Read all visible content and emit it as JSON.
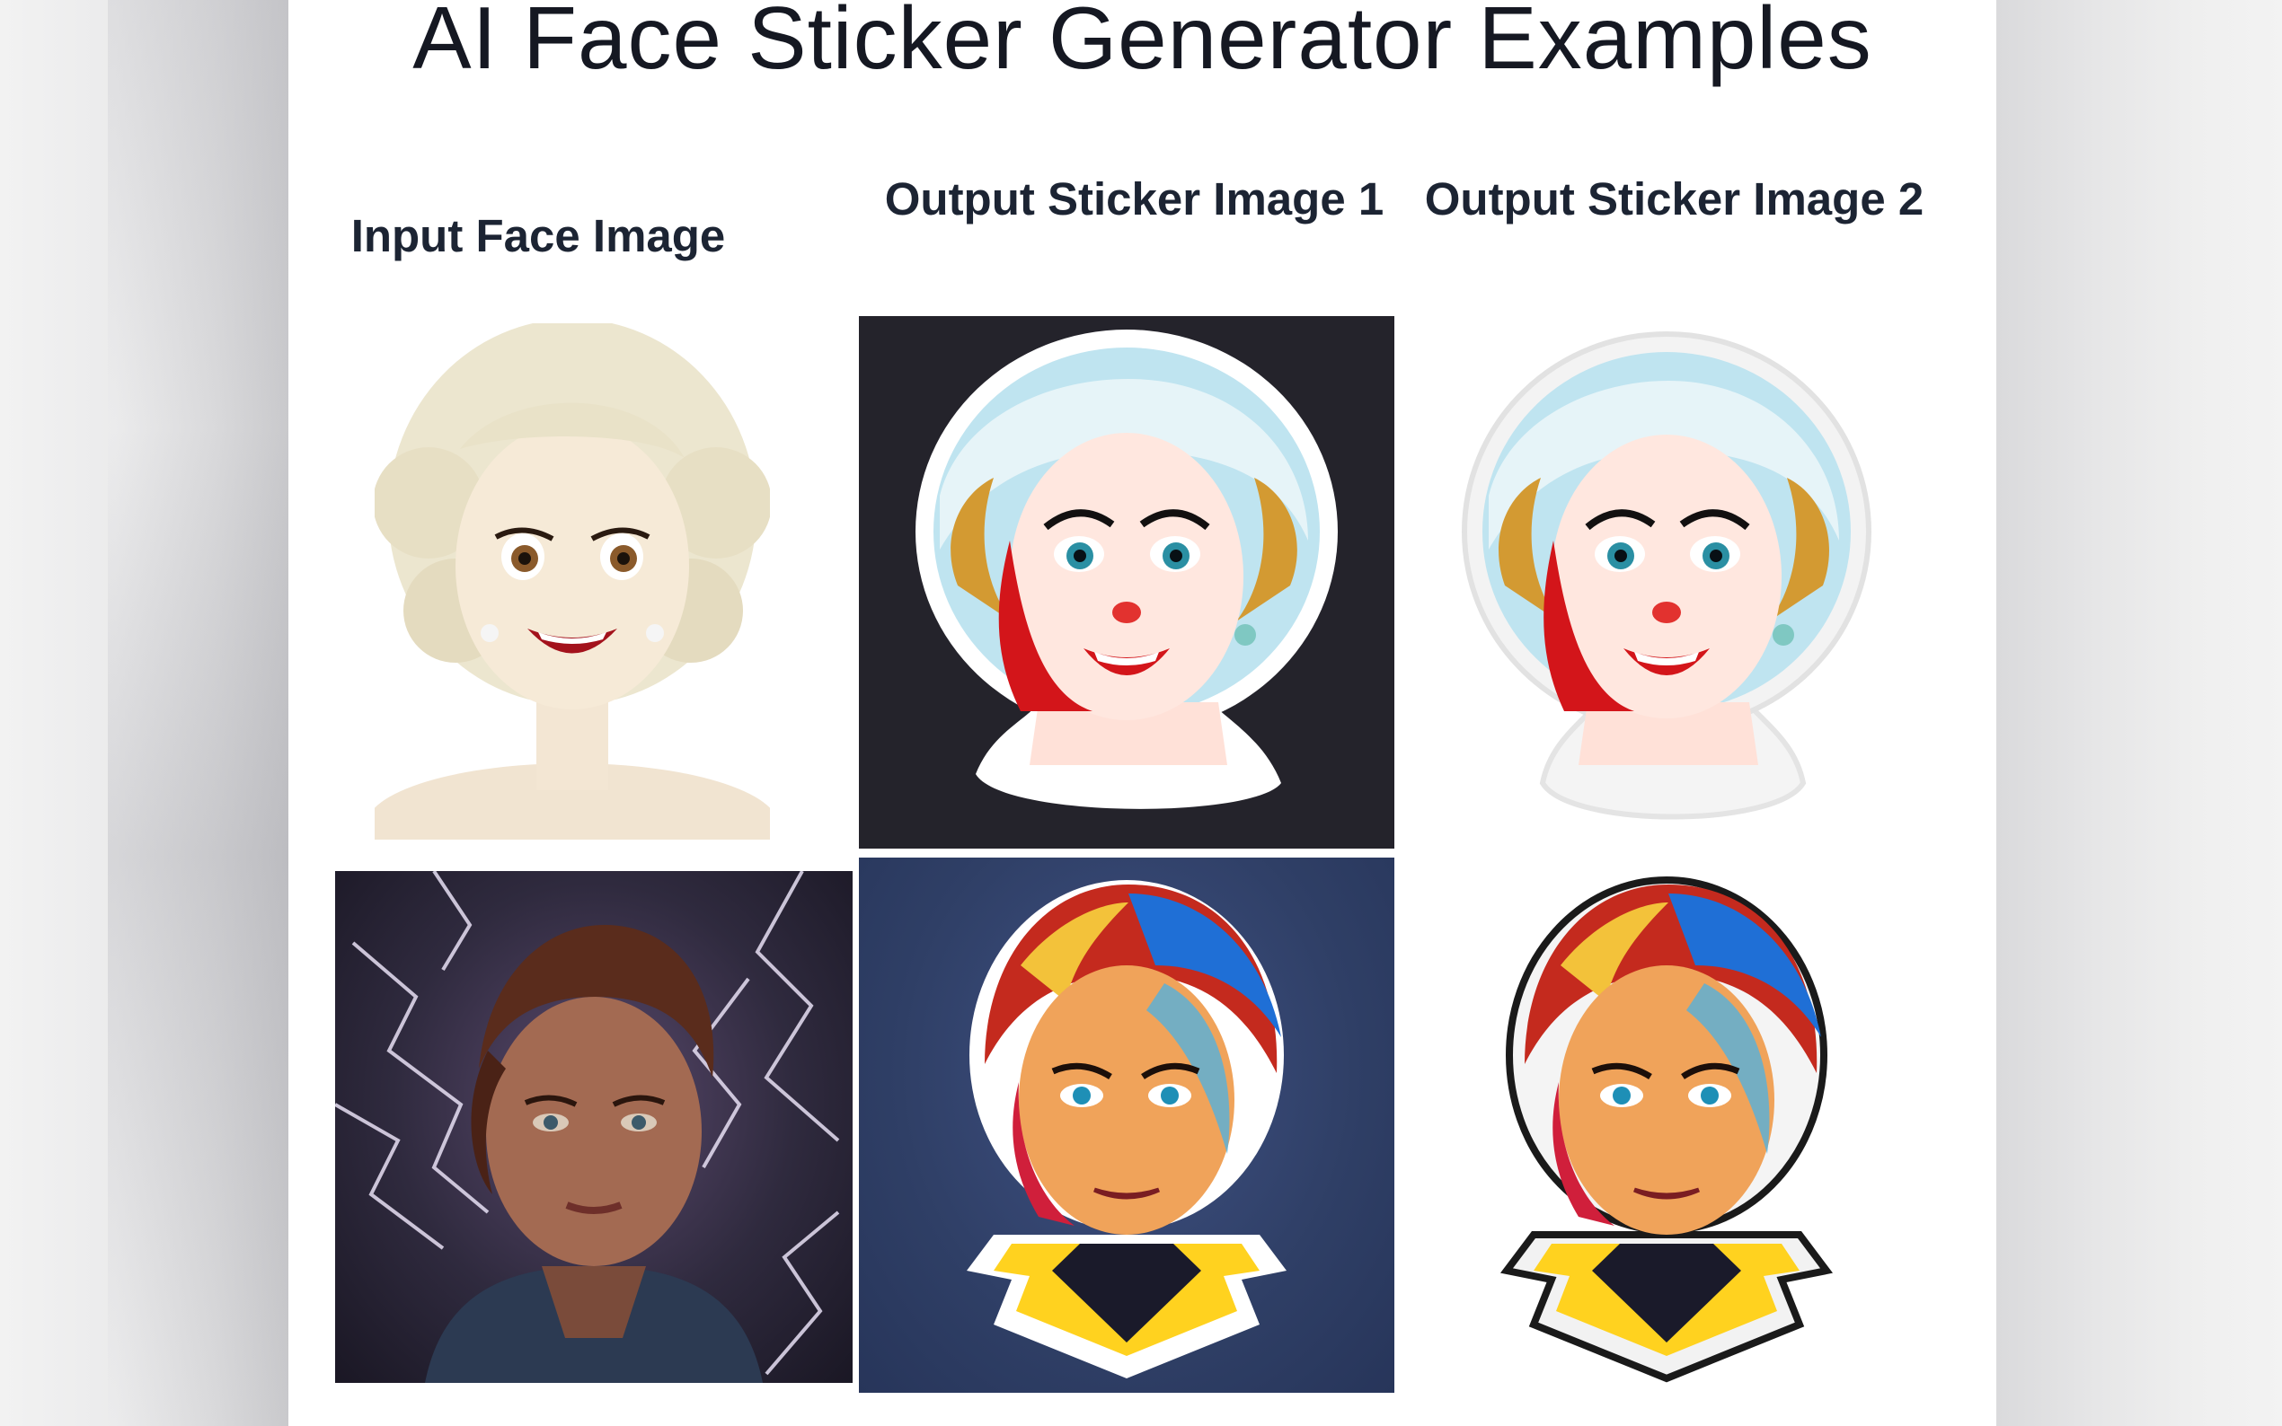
{
  "page": {
    "title": "AI Face Sticker Generator Examples"
  },
  "table": {
    "headers": [
      "Input Face Image",
      "Output Sticker Image 1",
      "Output Sticker Image 2"
    ],
    "rows": [
      {
        "input": {
          "subject": "emoji-style woman with platinum curly hair",
          "background": "#ffffff"
        },
        "output1": {
          "subject": "pop-art sticker, platinum curls, red lips",
          "background": "#24232b"
        },
        "output2": {
          "subject": "pop-art sticker, platinum curls, red lips",
          "background": "#ffffff"
        }
      },
      {
        "input": {
          "subject": "photo of woman with auburn hair, lightning behind",
          "background": "#3a2f4a"
        },
        "output1": {
          "subject": "comic sticker, red/blue hair, lightning collar",
          "background": "#2f3f66"
        },
        "output2": {
          "subject": "comic sticker, red/blue hair, lightning collar",
          "background": "#ffffff"
        }
      }
    ]
  },
  "colors": {
    "text": "#151822",
    "panel": "#ffffff",
    "sidebar": "#e9e9ea"
  }
}
